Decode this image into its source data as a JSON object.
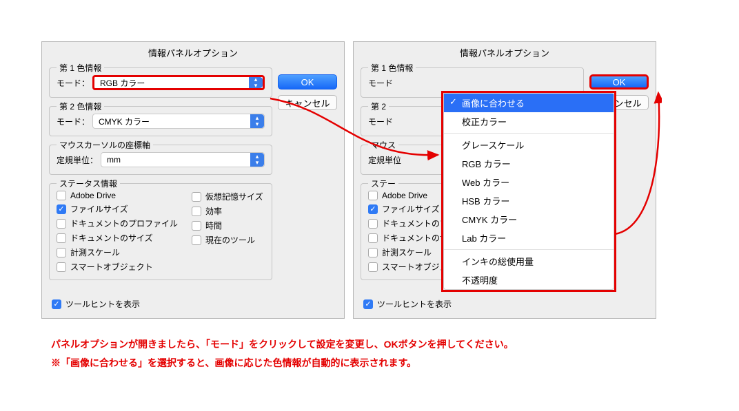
{
  "dialog_title": "情報パネルオプション",
  "group1": {
    "legend": "第 1 色情報",
    "mode_label": "モード：",
    "mode_value_left": "RGB カラー"
  },
  "group2": {
    "legend": "第 2 色情報",
    "mode_label": "モード：",
    "mode_value": "CMYK カラー"
  },
  "ruler": {
    "legend": "マウスカーソルの座標軸",
    "label": "定規単位：",
    "value": "mm"
  },
  "status": {
    "legend": "ステータス情報",
    "left": [
      {
        "label": "Adobe Drive",
        "checked": false
      },
      {
        "label": "ファイルサイズ",
        "checked": true
      },
      {
        "label": "ドキュメントのプロファイル",
        "checked": false
      },
      {
        "label": "ドキュメントのサイズ",
        "checked": false
      },
      {
        "label": "計測スケール",
        "checked": false
      },
      {
        "label": "スマートオブジェクト",
        "checked": false
      }
    ],
    "right": [
      {
        "label": "仮想記憶サイズ",
        "checked": false
      },
      {
        "label": "効率",
        "checked": false
      },
      {
        "label": "時間",
        "checked": false
      },
      {
        "label": "現在のツール",
        "checked": false
      }
    ]
  },
  "tooltips_label": "ツールヒントを表示",
  "buttons": {
    "ok": "OK",
    "cancel": "キャンセル"
  },
  "dropdown_items": [
    "画像に合わせる",
    "校正カラー",
    "グレースケール",
    "RGB カラー",
    "Web カラー",
    "HSB カラー",
    "CMYK カラー",
    "Lab カラー",
    "インキの総使用量",
    "不透明度"
  ],
  "ruler_right_placeholder": "定規単位",
  "mode_right_placeholder": "モード",
  "group2_right_placeholder": "第 2",
  "mouse_right_placeholder": "マウス",
  "status_right_placeholder": "ステー",
  "instruction_line1": "パネルオプションが開きましたら、「モード」をクリックして設定を変更し、OKボタンを押してください。",
  "instruction_line2": "※「画像に合わせる」を選択すると、画像に応じた色情報が自動的に表示されます。"
}
